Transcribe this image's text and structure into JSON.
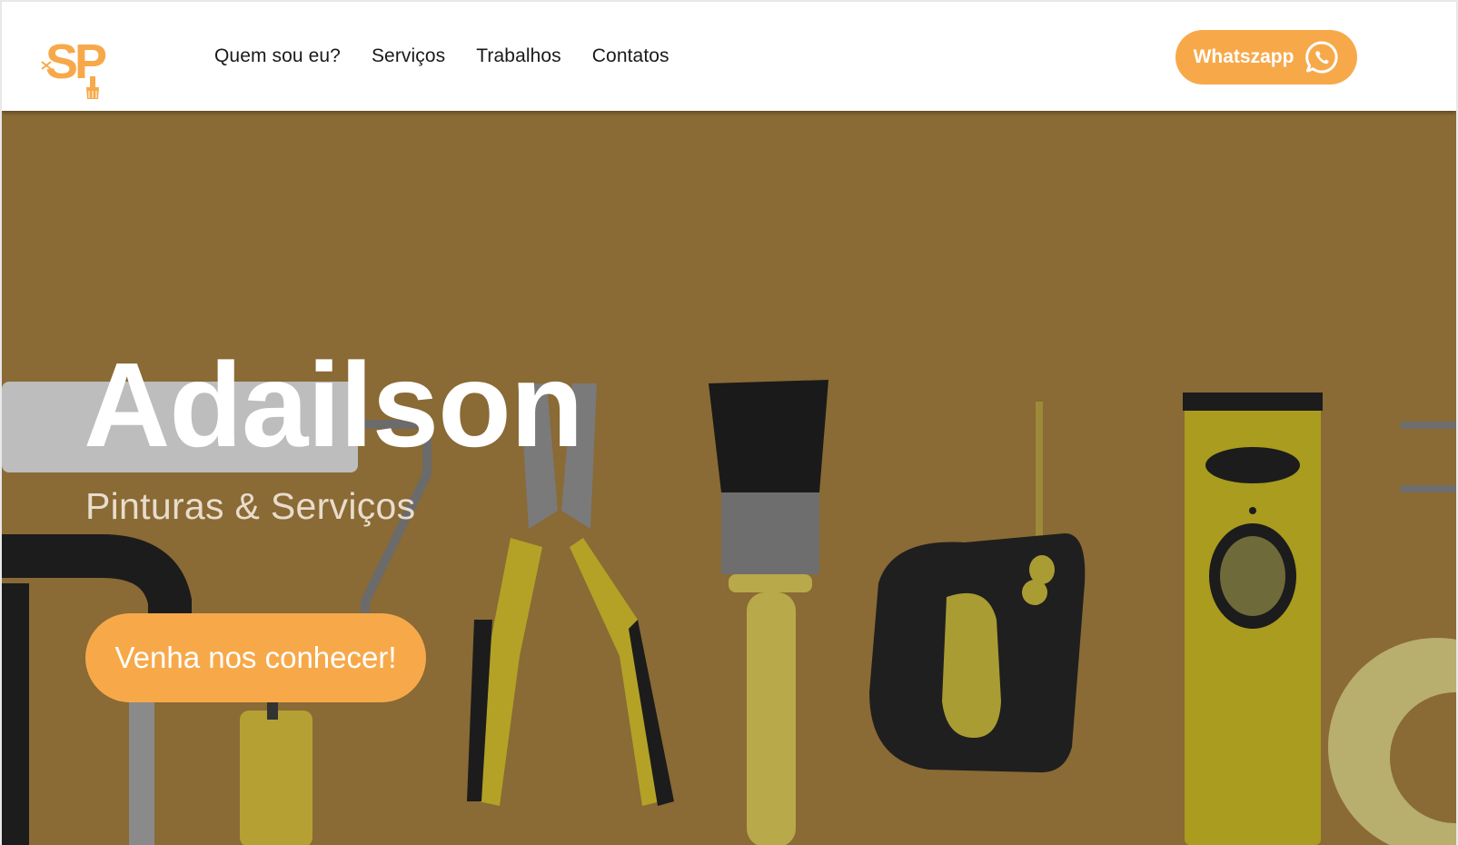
{
  "brand": {
    "logo_text": "SP",
    "logo_icon": "paintbrush-icon"
  },
  "nav": {
    "items": [
      {
        "label": "Quem sou eu?"
      },
      {
        "label": "Serviços"
      },
      {
        "label": "Trabalhos"
      },
      {
        "label": "Contatos"
      }
    ]
  },
  "header_button": {
    "label": "Whatszapp",
    "icon": "whatsapp-icon"
  },
  "hero": {
    "title": "Adailson",
    "subtitle": "Pinturas & Serviços",
    "cta_label": "Venha nos conhecer!",
    "background_subject": "tools-flat-lay"
  },
  "colors": {
    "accent": "#f7a94a",
    "hero_overlay": "#7e5e2f",
    "header_bg": "#ffffff",
    "nav_text": "#1a1a1a"
  }
}
